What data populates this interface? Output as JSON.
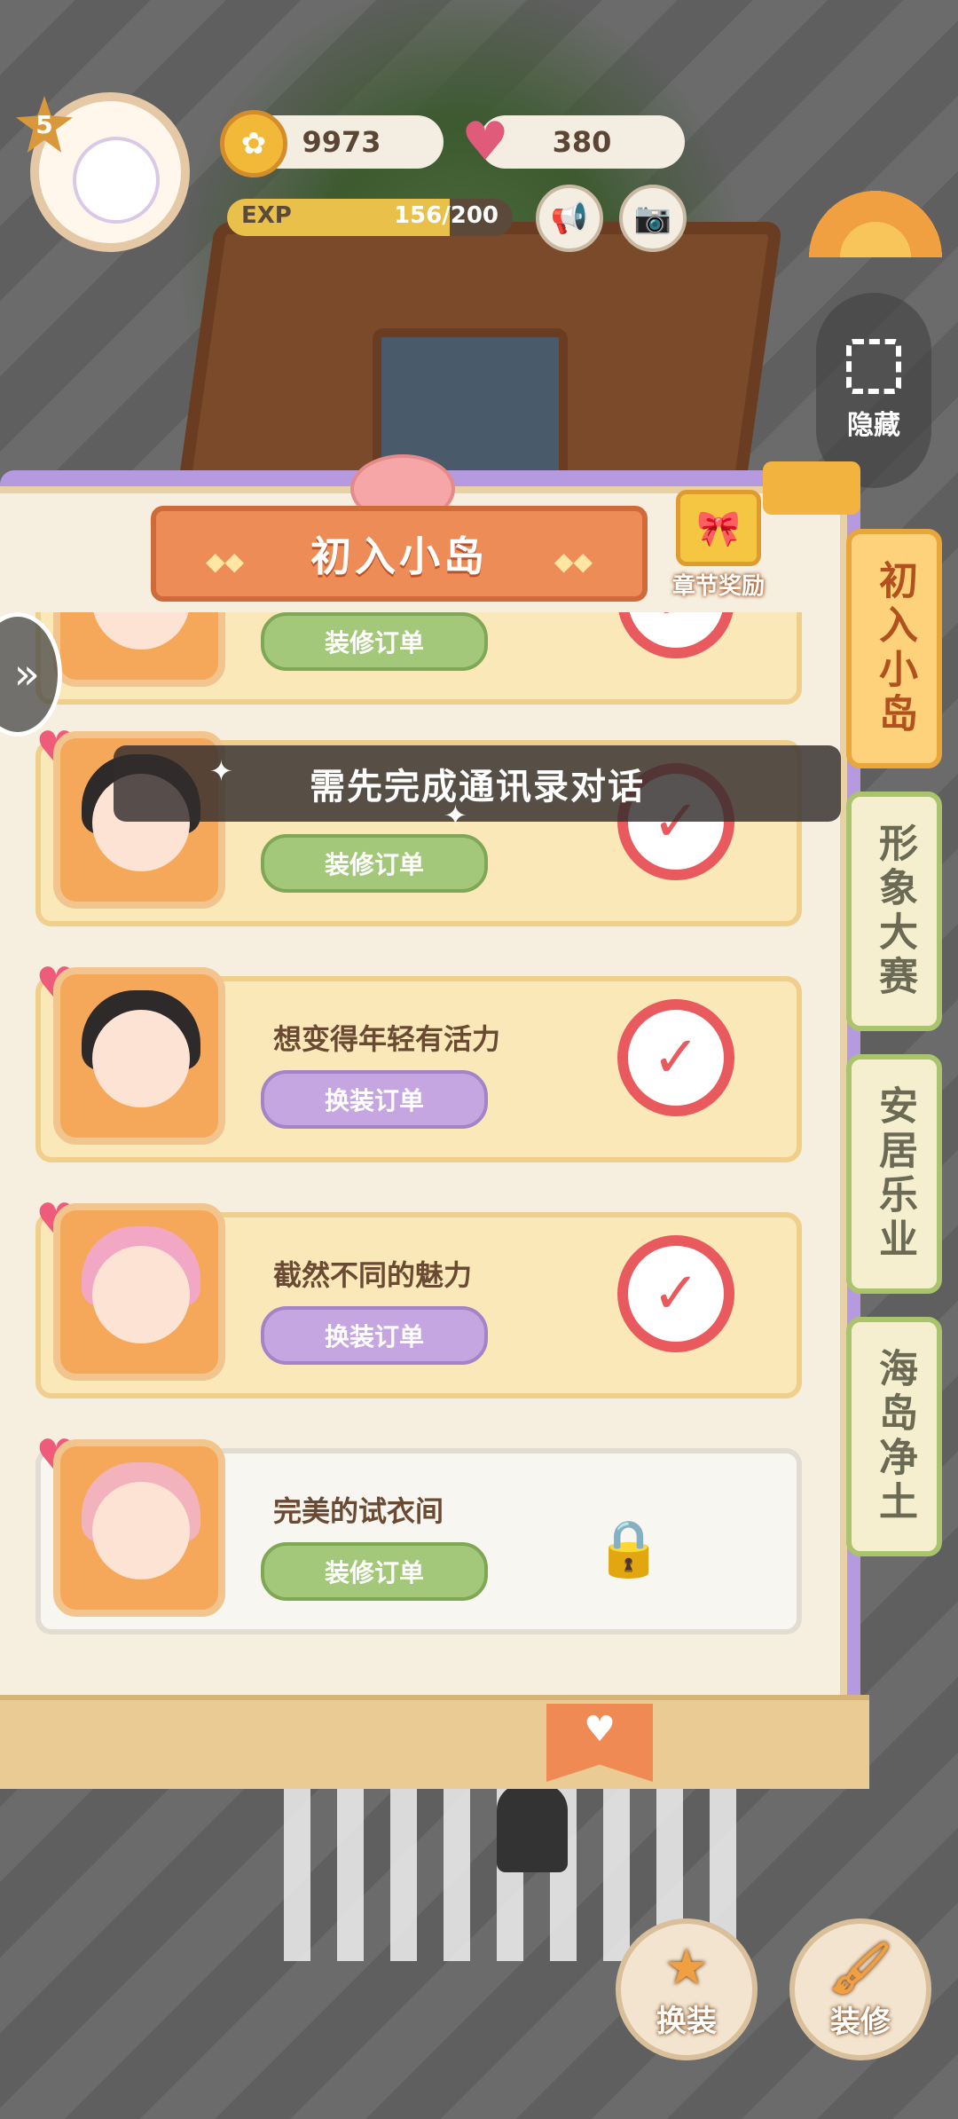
{
  "hud": {
    "level": "5",
    "coins": "9973",
    "hearts": "380",
    "exp_label": "EXP",
    "exp_value": "156/200",
    "exp_progress": 0.78
  },
  "side_panel": {
    "hide_label": "隐藏"
  },
  "chapter": {
    "title": "初入小岛",
    "reward_label": "章节奖励"
  },
  "toast": "需先完成通讯录对话",
  "orders": [
    {
      "name": "",
      "button": "装修订单",
      "button_type": "green",
      "status": "completed"
    },
    {
      "name": "",
      "button": "装修订单",
      "button_type": "green",
      "status": "completed"
    },
    {
      "name": "想变得年轻有活力",
      "button": "换装订单",
      "button_type": "purple",
      "status": "completed"
    },
    {
      "name": "截然不同的魅力",
      "button": "换装订单",
      "button_type": "purple",
      "status": "completed"
    },
    {
      "name": "完美的试衣间",
      "button": "装修订单",
      "button_type": "green",
      "status": "locked"
    }
  ],
  "tabs": [
    {
      "label": "初入小岛",
      "active": true
    },
    {
      "label": "形象大赛",
      "active": false
    },
    {
      "label": "安居乐业",
      "active": false
    },
    {
      "label": "海岛净土",
      "active": false
    }
  ],
  "bottom": {
    "dress_label": "换装",
    "decorate_label": "装修"
  },
  "icons": {
    "coin": "rabbit-coin-icon",
    "heart": "heart-icon",
    "megaphone": "megaphone-icon",
    "camera": "camera-icon",
    "stamp": "checkmark-stamp-icon",
    "lock": "lock-icon"
  },
  "colors": {
    "active_tab": "#fdd27a",
    "inactive_tab": "#f5efcf",
    "ribbon": "#ee8c58",
    "green_button": "#a4c87a",
    "purple_button": "#c6a6e0",
    "stamp_red": "#e85a5e"
  }
}
